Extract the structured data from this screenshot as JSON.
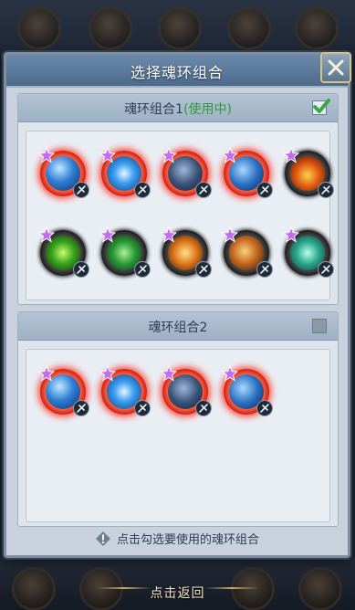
{
  "dialog": {
    "title": "选择魂环组合",
    "close_icon": "close-icon"
  },
  "combos": [
    {
      "label": "魂环组合1",
      "status": "(使用中)",
      "checked": true,
      "rings": [
        {
          "frame": "red",
          "orb": "blue",
          "icon": "spirit-beast-icon"
        },
        {
          "frame": "red",
          "orb": "blue2",
          "icon": "spirit-beast-icon"
        },
        {
          "frame": "red",
          "orb": "armor",
          "icon": "spirit-beast-icon"
        },
        {
          "frame": "red",
          "orb": "fish",
          "icon": "spirit-beast-icon"
        },
        {
          "frame": "black",
          "orb": "fire",
          "icon": "spirit-beast-icon"
        },
        {
          "frame": "black",
          "orb": "leaf",
          "icon": "spirit-beast-icon"
        },
        {
          "frame": "black",
          "orb": "leaf2",
          "icon": "spirit-beast-icon"
        },
        {
          "frame": "black",
          "orb": "phoenix",
          "icon": "spirit-beast-icon"
        },
        {
          "frame": "black",
          "orb": "phoenix2",
          "icon": "spirit-beast-icon"
        },
        {
          "frame": "black",
          "orb": "spirit",
          "icon": "spirit-beast-icon"
        }
      ]
    },
    {
      "label": "魂环组合2",
      "status": "",
      "checked": false,
      "rings": [
        {
          "frame": "red",
          "orb": "blue",
          "icon": "spirit-beast-icon"
        },
        {
          "frame": "red",
          "orb": "blue2",
          "icon": "spirit-beast-icon"
        },
        {
          "frame": "red",
          "orb": "armor",
          "icon": "spirit-beast-icon"
        },
        {
          "frame": "red",
          "orb": "fish",
          "icon": "spirit-beast-icon"
        }
      ]
    }
  ],
  "hint": "点击勾选要使用的魂环组合",
  "return_label": "点击返回",
  "colors": {
    "status_green": "#2f9a3c",
    "star_purple": "#c46cf0",
    "ring_red": "#ff3b2a"
  }
}
